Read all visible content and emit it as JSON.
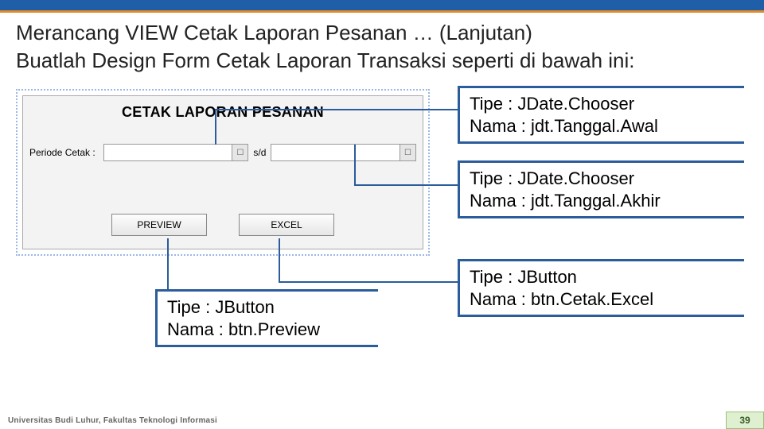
{
  "header": {
    "title": "Merancang VIEW Cetak Laporan Pesanan … (Lanjutan)",
    "subtitle": "Buatlah Design Form Cetak Laporan Transaksi seperti di bawah ini:"
  },
  "form": {
    "title": "CETAK LAPORAN PESANAN",
    "periode_label": "Periode Cetak :",
    "separator": "s/d",
    "btn_preview": "PREVIEW",
    "btn_excel": "EXCEL"
  },
  "annotations": {
    "dateAwal": {
      "line1": "Tipe  : JDate.Chooser",
      "line2": "Nama : jdt.Tanggal.Awal"
    },
    "dateAkhir": {
      "line1": "Tipe  : JDate.Chooser",
      "line2": "Nama : jdt.Tanggal.Akhir"
    },
    "btnExcel": {
      "line1": "Tipe  : JButton",
      "line2": "Nama : btn.Cetak.Excel"
    },
    "btnPreview": {
      "line1": "Tipe  : JButton",
      "line2": "Nama : btn.Preview"
    }
  },
  "footer": {
    "org": "Universitas Budi Luhur, Fakultas Teknologi Informasi",
    "page": "39"
  }
}
